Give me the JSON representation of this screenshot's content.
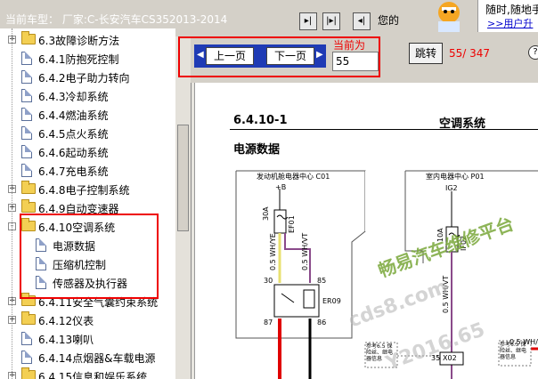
{
  "topbar": {
    "model_text": "当前车型：  厂家:C-长安汽车CS352013-2014",
    "pc_text": "您的",
    "ad_line1": "随时,随地手",
    "ad_line2": ">>用户升"
  },
  "tree": {
    "items": [
      {
        "label": "6.3故障诊断方法",
        "type": "folder",
        "expander": "+"
      },
      {
        "label": "6.4.1防抱死控制",
        "type": "doc"
      },
      {
        "label": "6.4.2电子助力转向",
        "type": "doc"
      },
      {
        "label": "6.4.3冷却系统",
        "type": "doc"
      },
      {
        "label": "6.4.4燃油系统",
        "type": "doc"
      },
      {
        "label": "6.4.5点火系统",
        "type": "doc"
      },
      {
        "label": "6.4.6起动系统",
        "type": "doc"
      },
      {
        "label": "6.4.7充电系统",
        "type": "doc"
      },
      {
        "label": "6.4.8电子控制系统",
        "type": "folder",
        "expander": "+"
      },
      {
        "label": "6.4.9自动变速器",
        "type": "folder",
        "expander": "+"
      },
      {
        "label": "6.4.10空调系统",
        "type": "folder",
        "expander": "-"
      },
      {
        "label": "电源数据",
        "type": "doc"
      },
      {
        "label": "压缩机控制",
        "type": "doc"
      },
      {
        "label": "传感器及执行器",
        "type": "doc"
      },
      {
        "label": "6.4.11安全气囊约束系统",
        "type": "folder",
        "expander": "+"
      },
      {
        "label": "6.4.12仪表",
        "type": "folder",
        "expander": "+"
      },
      {
        "label": "6.4.13喇叭",
        "type": "doc"
      },
      {
        "label": "6.4.14点烟器&车载电源",
        "type": "doc"
      },
      {
        "label": "6.4.15信息和娱乐系统",
        "type": "folder",
        "expander": "+"
      }
    ]
  },
  "nav": {
    "prev_label": "上一页",
    "next_label": "下一页",
    "current_page_label": "当前为",
    "page_value": "55",
    "jump_label": "跳转",
    "page_count": "55/ 347"
  },
  "document": {
    "number": "6.4.10-1",
    "title": "空调系统",
    "subtitle": "电源数据",
    "box1_label": "发动机舱电器中心 C01",
    "box2_label": "室内电器中心 P01",
    "plus_b": "+B",
    "ig2": "IG2",
    "fuse1_rating": "30A",
    "fuse1_name": "EF01",
    "fuse2_rating": "10A",
    "fuse2_name": "IF02",
    "relay_name": "ER09",
    "wire1": "0.5 WH/YE",
    "wire2": "0.5 WH/VT",
    "wire3": "0.5 WH/RD",
    "pin30": "30",
    "pin85": "85",
    "pin87": "87",
    "pin86": "86",
    "pin35": "35",
    "connector": "X02",
    "ref_note": "参考6.5 保险丝、继电器信息"
  },
  "watermarks": {
    "line1": "畅易汽车维修平台",
    "line2": "cds8.com",
    "line3": "Y2016.65"
  },
  "colors": {
    "chrome": "#d4d0c8",
    "nav_blue": "#1f3bb5",
    "highlight_red": "#e00000",
    "wire_red": "#e00000",
    "wire_purple": "#8a4a8a",
    "wire_yellow": "#e8e070",
    "watermark_green": "#7aa83a"
  }
}
